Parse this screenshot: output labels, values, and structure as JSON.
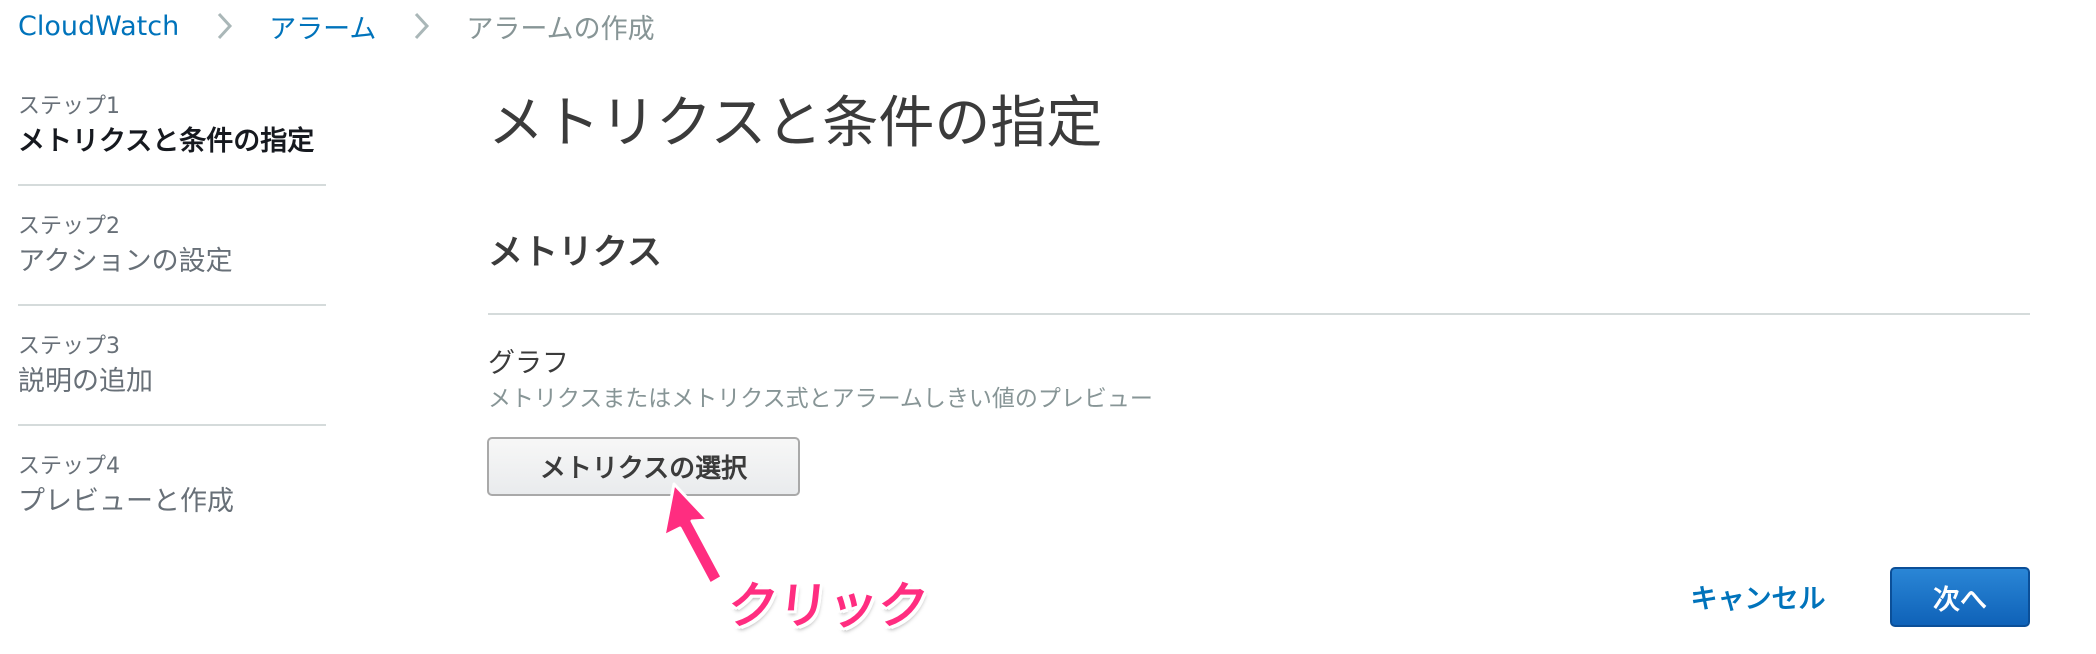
{
  "breadcrumb": {
    "items": [
      {
        "label": "CloudWatch",
        "link": true
      },
      {
        "label": "アラーム",
        "link": true
      },
      {
        "label": "アラームの作成",
        "link": false
      }
    ]
  },
  "steps": [
    {
      "number": "ステップ1",
      "title": "メトリクスと条件の指定",
      "active": true
    },
    {
      "number": "ステップ2",
      "title": "アクションの設定",
      "active": false
    },
    {
      "number": "ステップ3",
      "title": "説明の追加",
      "active": false
    },
    {
      "number": "ステップ4",
      "title": "プレビューと作成",
      "active": false
    }
  ],
  "main": {
    "title": "メトリクスと条件の指定",
    "section_title": "メトリクス",
    "graph_label": "グラフ",
    "graph_description": "メトリクスまたはメトリクス式とアラームしきい値のプレビュー",
    "select_metric_button": "メトリクスの選択"
  },
  "footer": {
    "cancel_label": "キャンセル",
    "next_label": "次へ"
  },
  "annotation": {
    "text": "クリック",
    "color": "#ff2d80"
  },
  "colors": {
    "link": "#0073bb",
    "primary_button": "#1166bb"
  }
}
